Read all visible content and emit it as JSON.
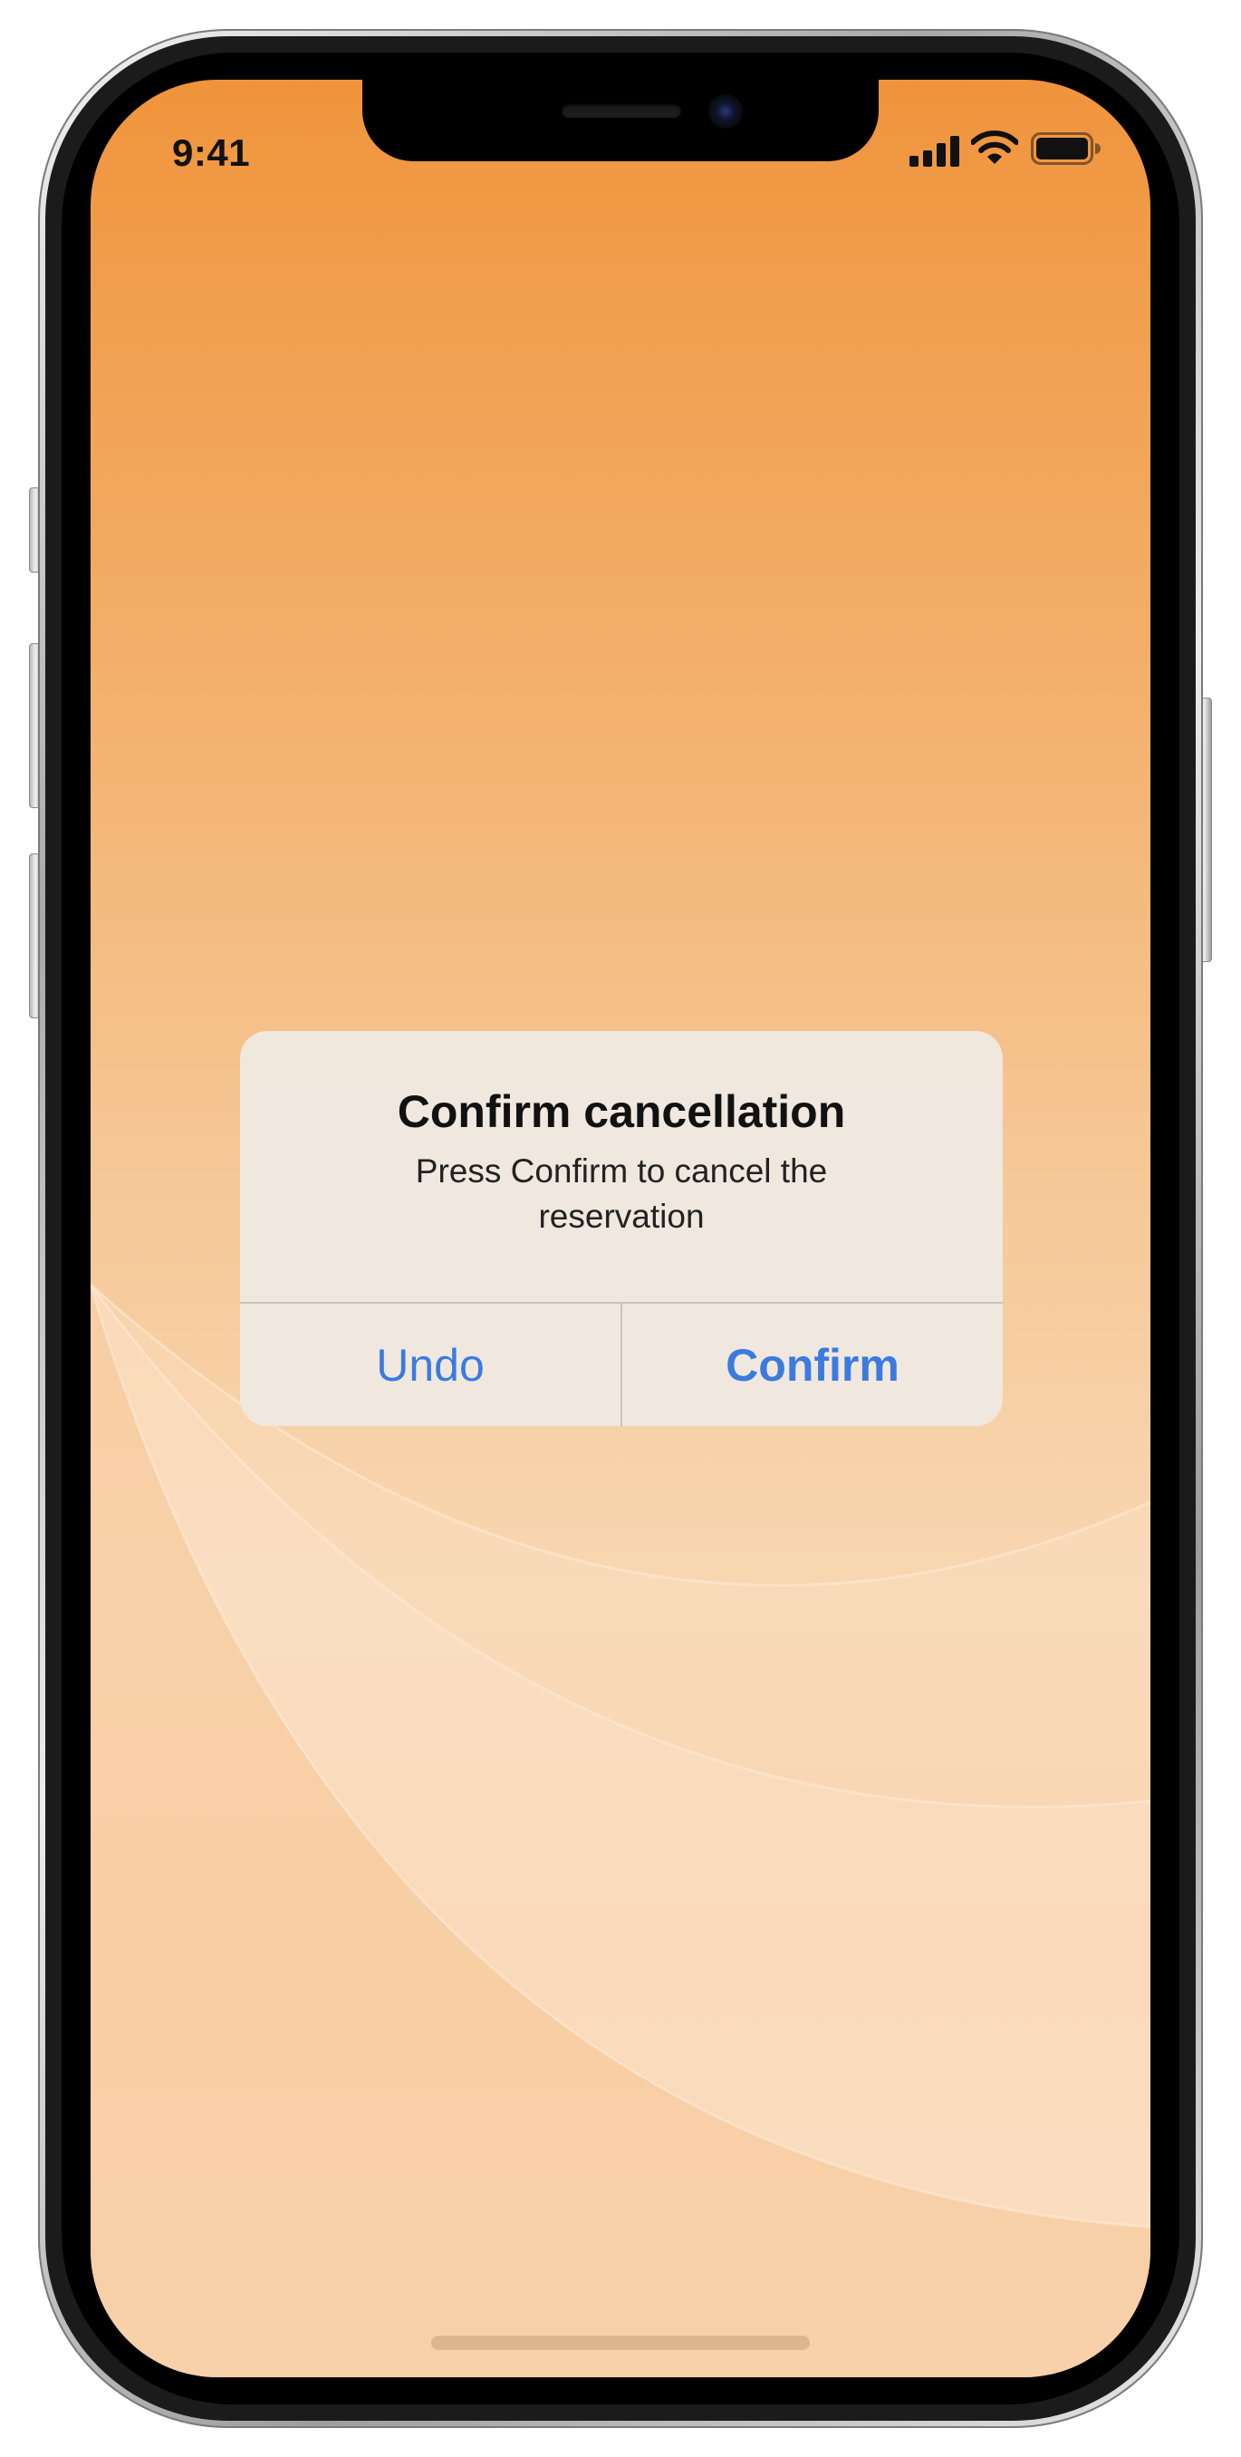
{
  "status_bar": {
    "time": "9:41"
  },
  "alert": {
    "title": "Confirm cancellation",
    "message": "Press Confirm to cancel the reservation",
    "buttons": {
      "undo_label": "Undo",
      "confirm_label": "Confirm"
    }
  },
  "colors": {
    "accent": "#3b7bdf",
    "background_top": "#f0943c",
    "background_bottom": "#f7d9b8",
    "alert_background": "#f0e8e0"
  },
  "icons": [
    "signal-icon",
    "wifi-icon",
    "battery-icon"
  ]
}
